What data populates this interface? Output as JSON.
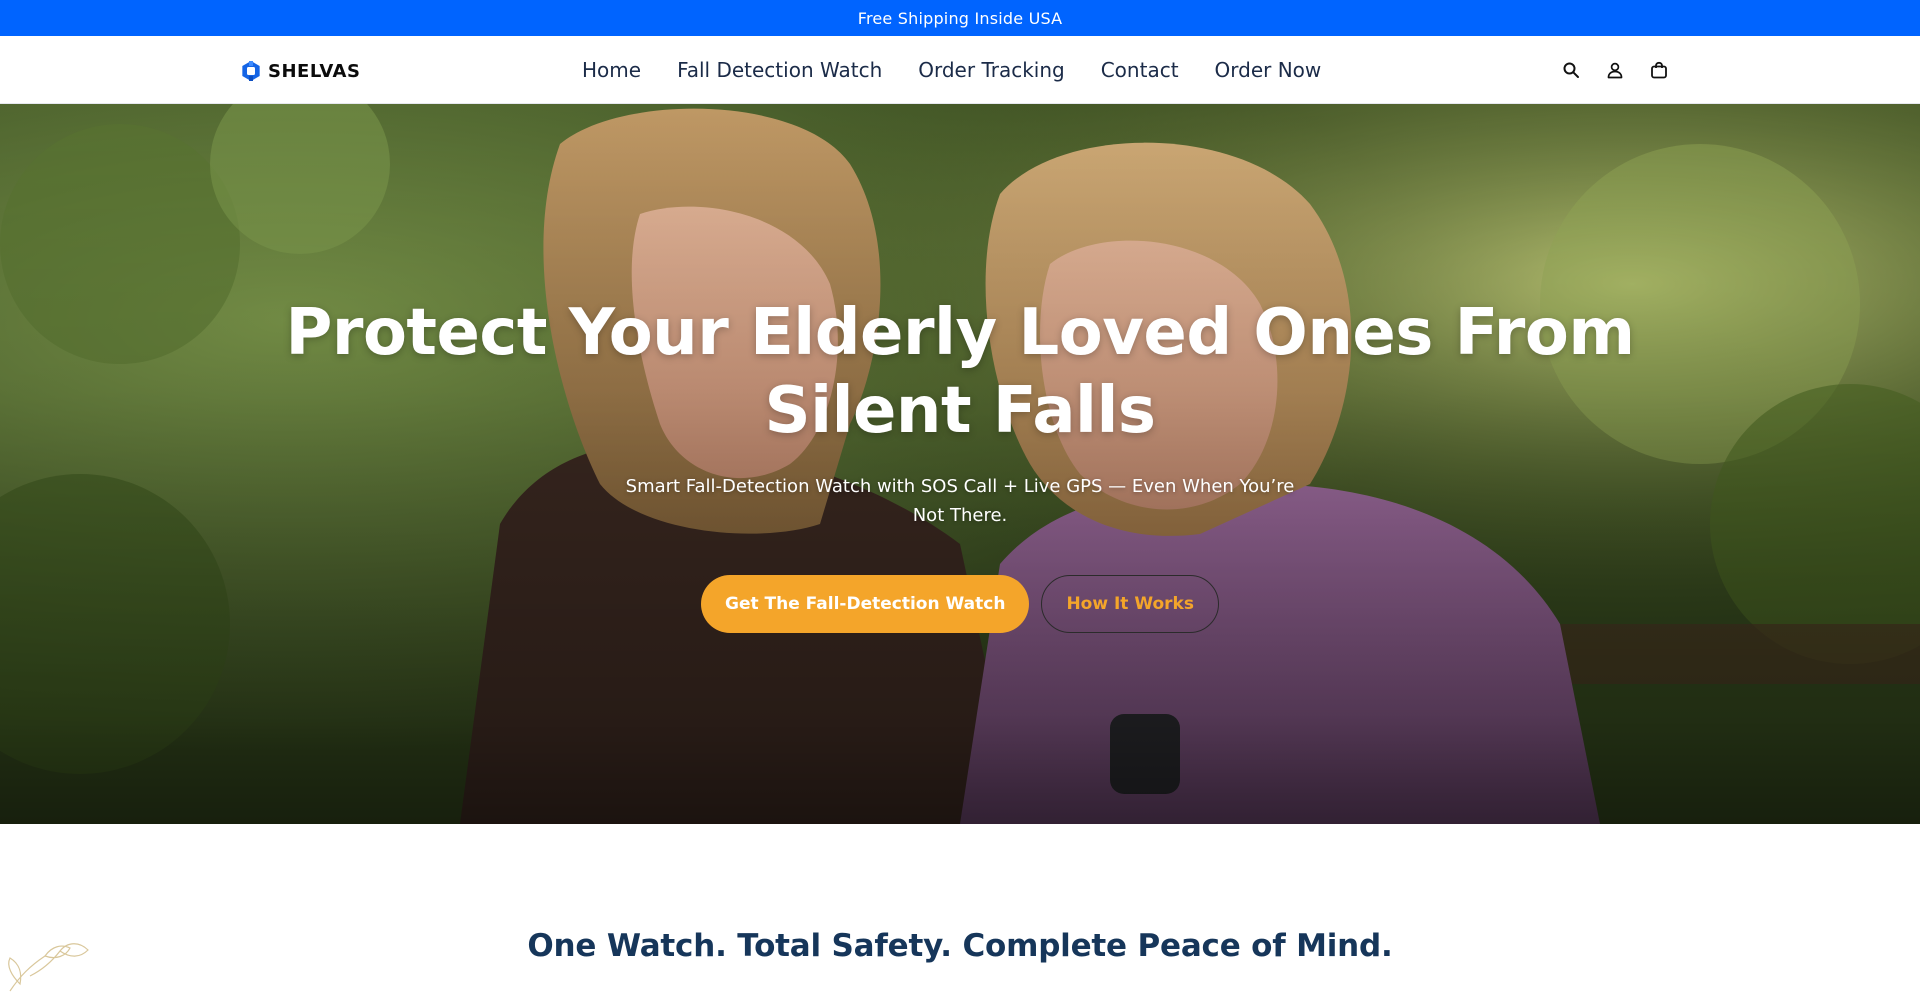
{
  "announcement": {
    "text": "Free Shipping Inside USA"
  },
  "header": {
    "brand": "SHELVAS",
    "nav": [
      {
        "label": "Home"
      },
      {
        "label": "Fall Detection Watch"
      },
      {
        "label": "Order Tracking"
      },
      {
        "label": "Contact"
      },
      {
        "label": "Order Now"
      }
    ],
    "icons": [
      "search-icon",
      "account-icon",
      "cart-icon"
    ]
  },
  "hero": {
    "title": "Protect Your Elderly Loved Ones From Silent Falls",
    "subtitle": "Smart Fall-Detection Watch with SOS Call + Live GPS — Even When You’re Not There.",
    "primary_cta": "Get The Fall-Detection Watch",
    "secondary_cta": "How It Works"
  },
  "section": {
    "title": "One Watch. Total Safety. Complete Peace of Mind."
  },
  "colors": {
    "announcement_bg": "#0064ff",
    "primary_button": "#f4a52a",
    "heading_navy": "#16365a",
    "logo_blue": "#1565e6"
  }
}
